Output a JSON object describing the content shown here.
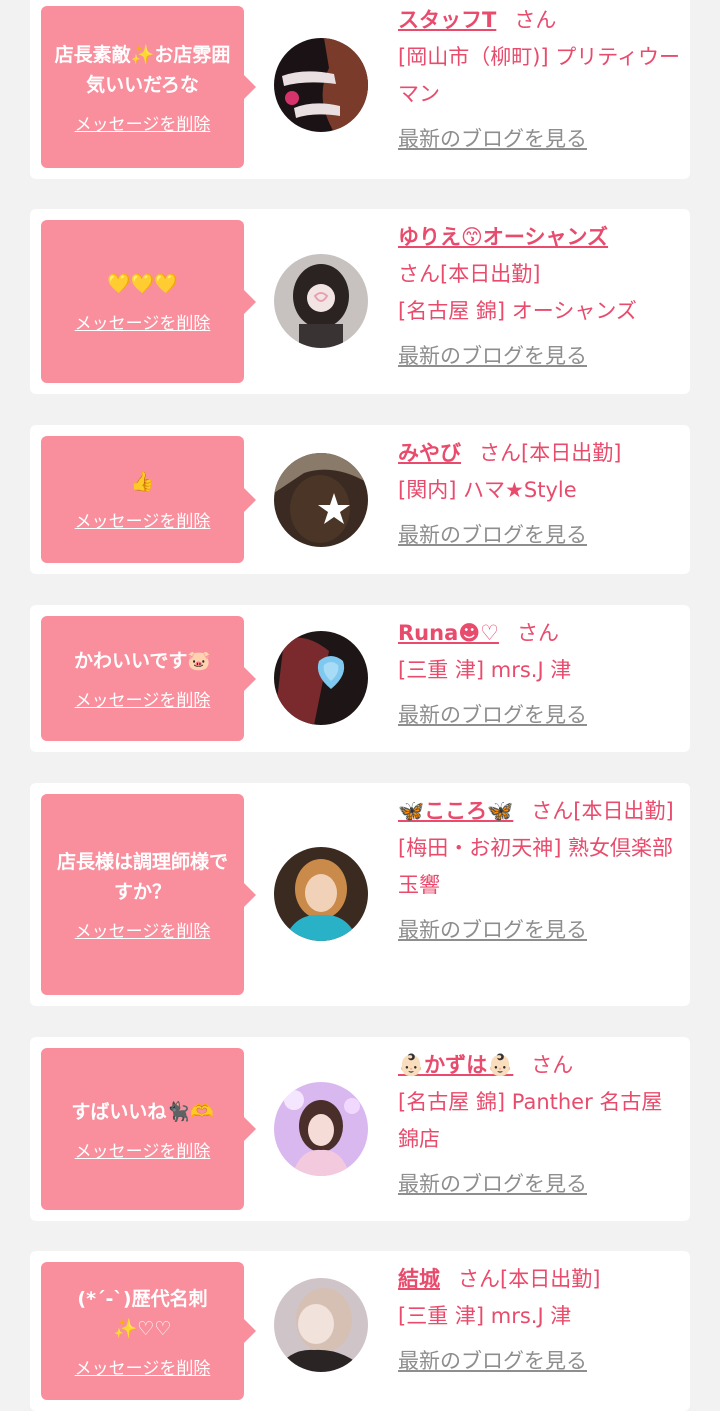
{
  "delete_label": "メッセージを削除",
  "blog_label": "最新のブログを見る",
  "san_label": "さん",
  "today_label": "[本日出勤]",
  "colors": {
    "accent": "#e84b6c",
    "bubble": "#f98f9d",
    "link_gray": "#8e8e8e",
    "background": "#f2f2f2"
  },
  "cards": [
    {
      "message": "店長素敵✨お店雰囲気いいだろな",
      "name": "スタッフT",
      "today": "",
      "shop": "[岡山市（柳町)] プリティウーマン",
      "avatar_icon": "pretty-woman-logo"
    },
    {
      "message": "💛💛💛",
      "name": "ゆりえ😙オーシャンズ",
      "today": "[本日出勤]",
      "shop": "[名古屋 錦] オーシャンズ",
      "avatar_icon": "profile-photo"
    },
    {
      "message": "👍",
      "name": "みやび",
      "today": "[本日出勤]",
      "shop": "[関内] ハマ★Style",
      "avatar_icon": "profile-photo"
    },
    {
      "message": "かわいいです🐷",
      "name": "Runa☻♡",
      "today": "",
      "shop": "[三重 津] mrs.J 津",
      "avatar_icon": "profile-photo"
    },
    {
      "message": "店長様は調理師様ですか？",
      "name": "🦋こころ🦋",
      "today": "[本日出勤]",
      "shop": "[梅田・お初天神] 熟女倶楽部 玉響",
      "avatar_icon": "profile-photo"
    },
    {
      "message": "すばいいね🐈‍⬛🫶",
      "name": "👶🏻かずは👶🏻",
      "today": "",
      "shop": "[名古屋 錦] Panther 名古屋錦店",
      "avatar_icon": "profile-photo"
    },
    {
      "message": "(*´-`)歴代名刺✨♡♡",
      "name": "結城",
      "today": "[本日出勤]",
      "shop": "[三重 津] mrs.J 津",
      "avatar_icon": "profile-photo"
    }
  ]
}
